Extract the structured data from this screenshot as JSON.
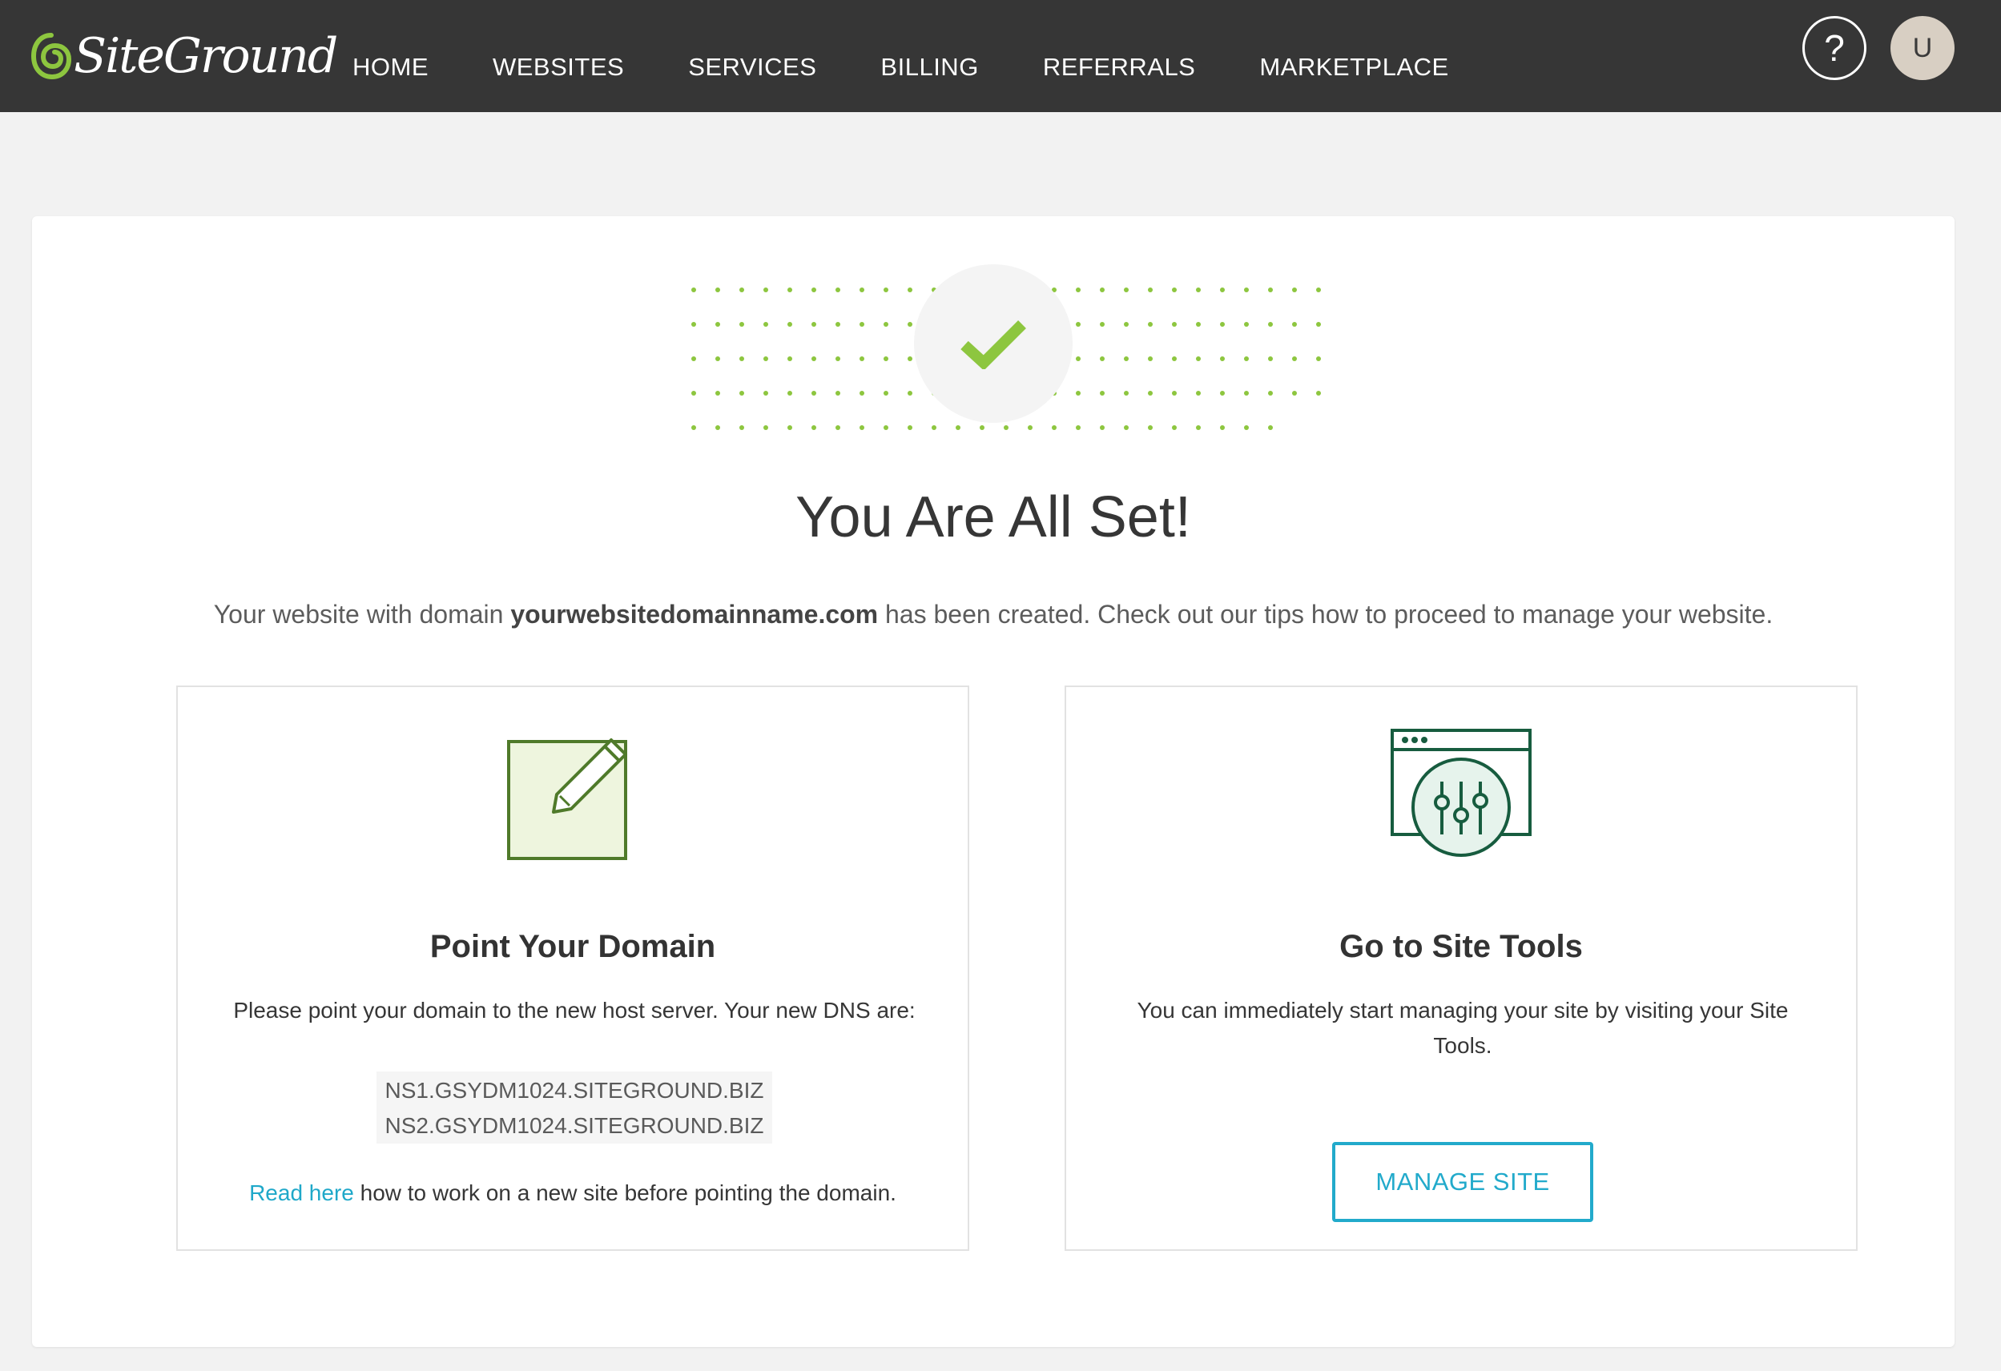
{
  "brand": {
    "name": "SiteGround",
    "accent": "#1fa8c9",
    "success": "#8dc63f",
    "nav_bg": "#363636"
  },
  "nav": {
    "items": [
      {
        "label": "HOME"
      },
      {
        "label": "WEBSITES"
      },
      {
        "label": "SERVICES"
      },
      {
        "label": "BILLING"
      },
      {
        "label": "REFERRALS"
      },
      {
        "label": "MARKETPLACE"
      }
    ],
    "help_label": "?",
    "avatar_initial": "U"
  },
  "hero": {
    "icon": "checkmark-icon",
    "title": "You Are All Set!",
    "lead_prefix": "Your website with domain ",
    "domain": "yourwebsitedomainname.com",
    "lead_suffix": " has been created. Check out our tips how to proceed to manage your website."
  },
  "tiles": {
    "domain": {
      "icon": "edit-note-icon",
      "title": "Point Your Domain",
      "text": "Please point your domain to the new host server. Your new DNS are:",
      "dns": [
        "NS1.GSYDM1024.SITEGROUND.BIZ",
        "NS2.GSYDM1024.SITEGROUND.BIZ"
      ],
      "link_label": "Read here",
      "link_suffix": " how to work on a new site before pointing the domain."
    },
    "tools": {
      "icon": "site-tools-icon",
      "title": "Go to Site Tools",
      "text": "You can immediately start managing your site by visiting your Site Tools.",
      "button_label": "MANAGE SITE"
    }
  }
}
